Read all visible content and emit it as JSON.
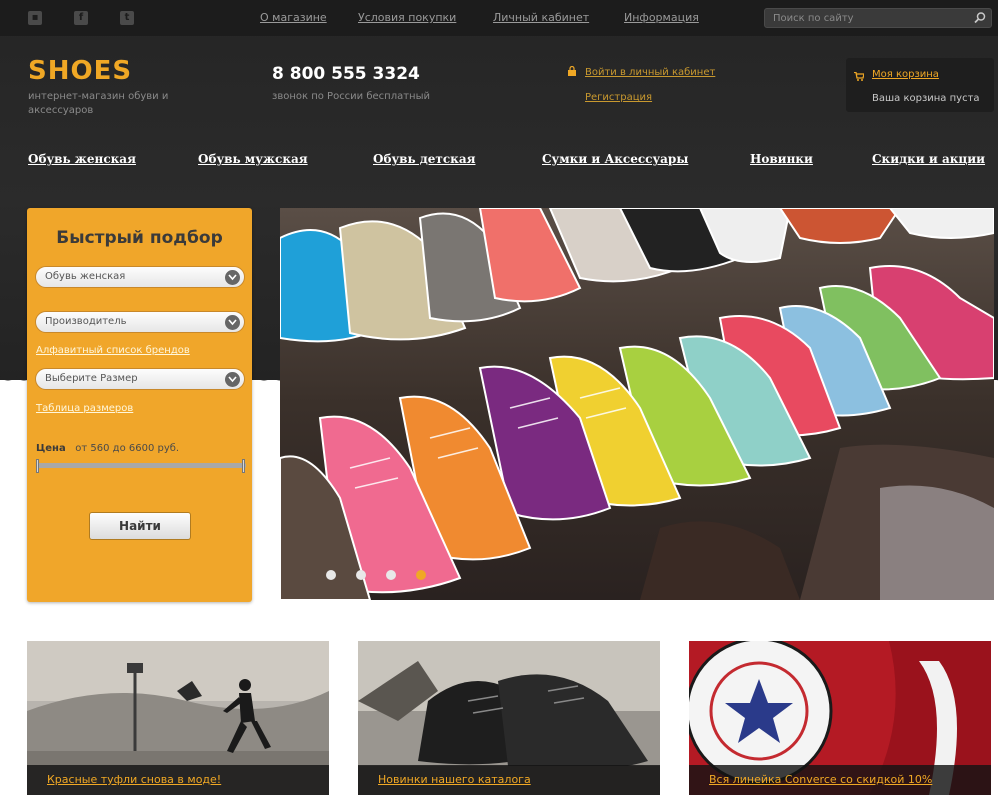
{
  "top_nav": [
    "О магазине",
    "Условия покупки",
    "Личный кабинет",
    "Информация"
  ],
  "search": {
    "placeholder": "Поиск по сайту"
  },
  "social_icons": [
    "vk-icon",
    "facebook-icon",
    "twitter-icon"
  ],
  "header": {
    "logo": "SHOES",
    "tagline": "интернет-магазин обуви и аксессуаров",
    "phone": "8 800 555 3324",
    "phone_note": "звонок по России бесплатный",
    "login_link": "Войти в личный кабинет",
    "register_link": "Регистрация",
    "cart_link": "Моя корзина",
    "cart_status": "Ваша корзина пуста"
  },
  "main_nav": [
    "Обувь женская",
    "Обувь мужская",
    "Обувь детская",
    "Сумки и Аксессуары",
    "Новинки",
    "Скидки и акции"
  ],
  "filter": {
    "title": "Быстрый подбор",
    "category": "Обувь женская",
    "brand": "Производитель",
    "brand_link": "Алфавитный список брендов",
    "size": "Выберите Размер",
    "size_link": "Таблица размеров",
    "price_label": "Цена",
    "price_range": "от 560 до 6600 руб.",
    "price_min": 560,
    "price_max": 6600,
    "button": "Найти"
  },
  "slider": {
    "slides": 4,
    "active": 4
  },
  "promos": [
    {
      "caption": "Красные туфли снова в моде!"
    },
    {
      "caption": "Новинки нашего каталога"
    },
    {
      "caption": "Вся линейка Converce со скидкой 10%"
    }
  ],
  "colors": {
    "accent": "#f0a825",
    "header_bg": "#2b2b2b",
    "panel": "#f0a62a"
  }
}
